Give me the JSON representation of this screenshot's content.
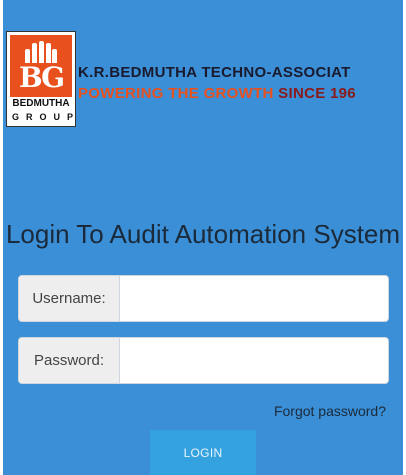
{
  "brand": {
    "logo_letters": "BG",
    "logo_name": "BEDMUTHA",
    "logo_group": "GROUP",
    "company_name": "K.R.BEDMUTHA TECHNO-ASSOCIAT",
    "tagline_part1": "POWERING THE GROWTH",
    "tagline_part2": "SINCE 196"
  },
  "login": {
    "title": "Login To Audit Automation System",
    "username_label": "Username:",
    "username_value": "",
    "password_label": "Password:",
    "password_value": "",
    "forgot_link": "Forgot password?",
    "submit_label": "LOGIN"
  },
  "colors": {
    "background": "#3a8fd7",
    "brand_orange": "#e8501e",
    "brand_maroon": "#8b1a1a",
    "button": "#35a2e0"
  }
}
